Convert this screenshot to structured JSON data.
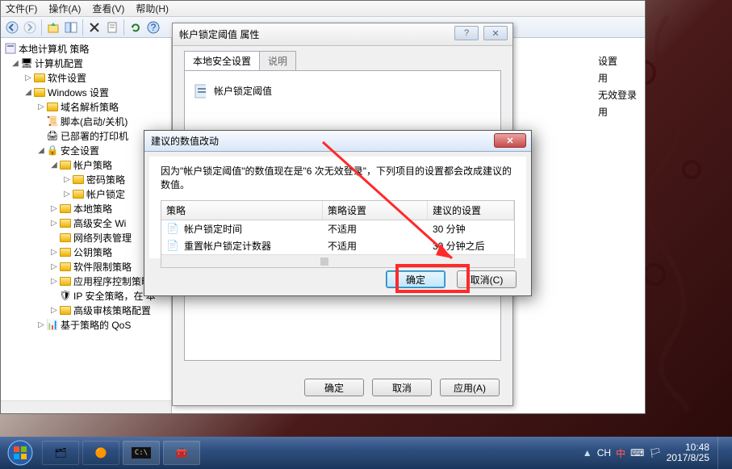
{
  "menubar": {
    "file": "文件(F)",
    "action": "操作(A)",
    "view": "查看(V)",
    "help": "帮助(H)"
  },
  "tree": {
    "root": "本地计算机 策略",
    "computer_config": "计算机配置",
    "software_settings": "软件设置",
    "windows_settings": "Windows 设置",
    "name_resolution": "域名解析策略",
    "scripts": "脚本(启动/关机)",
    "deployed_printers": "已部署的打印机",
    "security_settings": "安全设置",
    "account_policies": "帐户策略",
    "password_policy": "密码策略",
    "account_lockout_policy": "帐户锁定",
    "local_policies": "本地策略",
    "advanced_wf": "高级安全 Wi",
    "network_list": "网络列表管理",
    "public_key": "公钥策略",
    "software_restriction": "软件限制策略",
    "app_control": "应用程序控制策略",
    "ip_security": "IP 安全策略，在 本",
    "advanced_audit": "高级审核策略配置",
    "policy_qos": "基于策略的 QoS"
  },
  "right_hints": {
    "a": "设置",
    "b": "用",
    "c": "无效登录",
    "d": "用"
  },
  "prop_dialog": {
    "title": "帐户锁定阈值 属性",
    "tab1": "本地安全设置",
    "tab2": "说明",
    "policy_name": "帐户锁定阈值",
    "ok": "确定",
    "cancel": "取消",
    "apply": "应用(A)"
  },
  "confirm_dialog": {
    "title": "建议的数值改动",
    "message": "因为\"帐户锁定阈值\"的数值现在是\"6 次无效登录\"，下列项目的设置都会改成建议的数值。",
    "col_policy": "策略",
    "col_setting": "策略设置",
    "col_suggested": "建议的设置",
    "rows": [
      {
        "policy": "帐户锁定时间",
        "setting": "不适用",
        "suggested": "30 分钟"
      },
      {
        "policy": "重置帐户锁定计数器",
        "setting": "不适用",
        "suggested": "30 分钟之后"
      }
    ],
    "ok": "确定",
    "cancel": "取消(C)"
  },
  "taskbar": {
    "lang": "CH",
    "ime": "㆗",
    "time": "10:48",
    "date": "2017/8/25"
  }
}
